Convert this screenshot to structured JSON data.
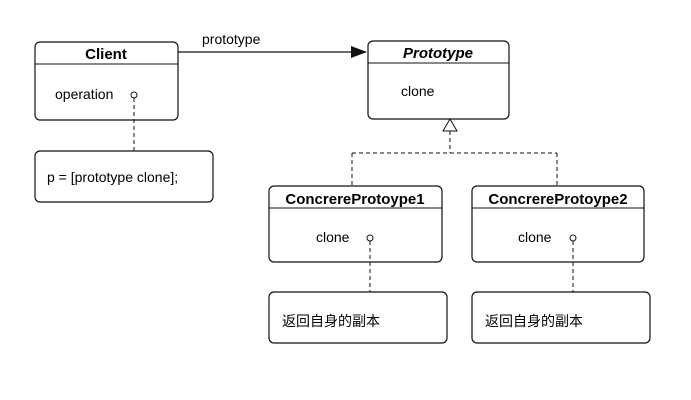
{
  "classes": {
    "client": {
      "name": "Client",
      "member": "operation"
    },
    "prototype": {
      "name": "Prototype",
      "member": "clone"
    },
    "concrete1": {
      "name": "ConcrereProtoype1",
      "member": "clone"
    },
    "concrete2": {
      "name": "ConcrereProtoype2",
      "member": "clone"
    }
  },
  "association": {
    "label": "prototype"
  },
  "notes": {
    "client": "p = [prototype clone];",
    "concrete1": "返回自身的副本",
    "concrete2": "返回自身的副本"
  }
}
